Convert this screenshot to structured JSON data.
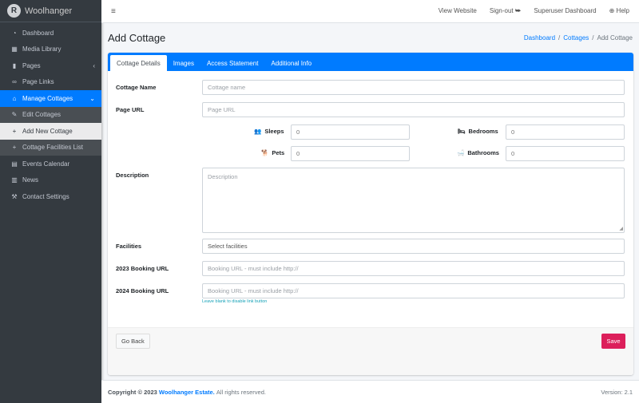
{
  "brand": {
    "name": "Woolhanger",
    "logo_letter": "R"
  },
  "sidebar": {
    "items": [
      {
        "label": "Dashboard",
        "icon": "dashboard-icon",
        "glyph": "◔"
      },
      {
        "label": "Media Library",
        "icon": "images-icon",
        "glyph": "▦"
      },
      {
        "label": "Pages",
        "icon": "file-icon",
        "glyph": "▮",
        "arrow": "‹"
      },
      {
        "label": "Page Links",
        "icon": "link-icon",
        "glyph": "∞"
      },
      {
        "label": "Manage Cottages",
        "icon": "home-icon",
        "glyph": "⌂",
        "arrow": "⌄"
      },
      {
        "label": "Edit Cottages",
        "icon": "edit-icon",
        "glyph": "✎"
      },
      {
        "label": "Add New Cottage",
        "icon": "plus-icon",
        "glyph": "+"
      },
      {
        "label": "Cottage Facilities List",
        "icon": "plus-icon",
        "glyph": "+"
      },
      {
        "label": "Events Calendar",
        "icon": "calendar-icon",
        "glyph": "▤"
      },
      {
        "label": "News",
        "icon": "newspaper-icon",
        "glyph": "▥"
      },
      {
        "label": "Contact Settings",
        "icon": "wrench-icon",
        "glyph": "⚒"
      }
    ]
  },
  "topbar": {
    "menu_glyph": "≡",
    "links": [
      "View Website",
      "Sign-out ⮩",
      "Superuser Dashboard",
      "⊕ Help"
    ]
  },
  "page": {
    "title": "Add Cottage",
    "breadcrumb": [
      "Dashboard",
      "Cottages",
      "Add Cottage"
    ]
  },
  "tabs": [
    "Cottage Details",
    "Images",
    "Access Statement",
    "Additional Info"
  ],
  "form": {
    "name_label": "Cottage Name",
    "name_placeholder": "Cottage name",
    "url_label": "Page URL",
    "url_placeholder": "Page URL",
    "sleeps_label": "Sleeps",
    "sleeps_value": "0",
    "sleeps_glyph": "👥",
    "bedrooms_label": "Bedrooms",
    "bedrooms_value": "0",
    "bedrooms_glyph": "🛏",
    "pets_label": "Pets",
    "pets_value": "0",
    "pets_glyph": "🐕",
    "bathrooms_label": "Bathrooms",
    "bathrooms_value": "0",
    "bathrooms_glyph": "🛁",
    "description_label": "Description",
    "description_placeholder": "Description",
    "facilities_label": "Facilities",
    "facilities_placeholder": "Select facilities",
    "booking2023_label": "2023 Booking URL",
    "booking2023_placeholder": "Booking URL - must include http://",
    "booking2024_label": "2024 Booking URL",
    "booking2024_placeholder": "Booking URL - must include http://",
    "booking_help": "Leave blank to disable link button"
  },
  "buttons": {
    "back": "Go Back",
    "save": "Save"
  },
  "footer": {
    "prefix": "Copyright © 2023",
    "company": "Woolhanger Estate.",
    "suffix": "All rights reserved.",
    "version": "Version: 2.1"
  },
  "colors": {
    "primary": "#007bff",
    "save": "#dc1f5b",
    "sidebar": "#343a40"
  }
}
